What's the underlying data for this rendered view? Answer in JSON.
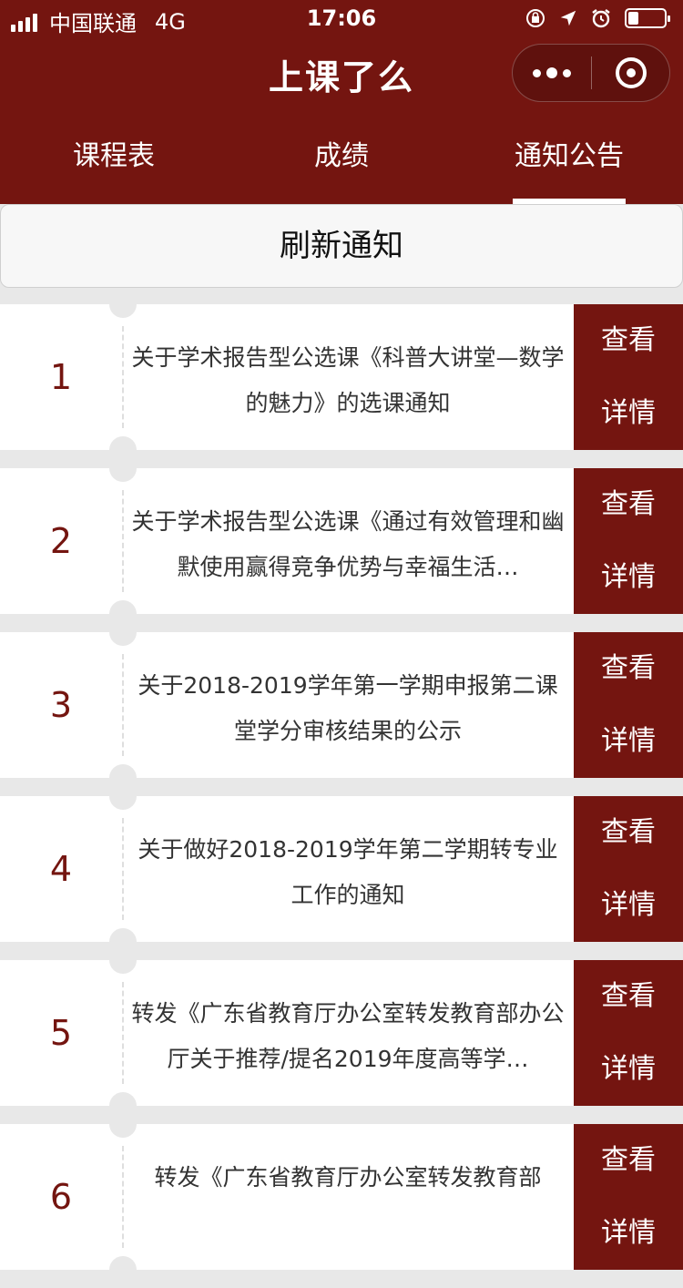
{
  "status_bar": {
    "carrier": "中国联通",
    "network": "4G",
    "time": "17:06",
    "battery_level": 0.25
  },
  "nav": {
    "title": "上课了么",
    "more_icon": "more-dots-icon",
    "close_icon": "target-circle-icon"
  },
  "tabs": [
    {
      "label": "课程表"
    },
    {
      "label": "成绩"
    },
    {
      "label": "通知公告"
    }
  ],
  "active_tab": 2,
  "refresh_button": "刷新通知",
  "notices": [
    {
      "num": "1",
      "title": "关于学术报告型公选课《科普大讲堂—数学的魅力》的选课通知",
      "detail_line1": "查看",
      "detail_line2": "详情"
    },
    {
      "num": "2",
      "title": "关于学术报告型公选课《通过有效管理和幽默使用赢得竞争优势与幸福生活…",
      "detail_line1": "查看",
      "detail_line2": "详情"
    },
    {
      "num": "3",
      "title": "关于2018-2019学年第一学期申报第二课堂学分审核结果的公示",
      "detail_line1": "查看",
      "detail_line2": "详情"
    },
    {
      "num": "4",
      "title": "关于做好2018-2019学年第二学期转专业工作的通知",
      "detail_line1": "查看",
      "detail_line2": "详情"
    },
    {
      "num": "5",
      "title": "转发《广东省教育厅办公室转发教育部办公厅关于推荐/提名2019年度高等学…",
      "detail_line1": "查看",
      "detail_line2": "详情"
    },
    {
      "num": "6",
      "title": "转发《广东省教育厅办公室转发教育部",
      "detail_line1": "查看",
      "detail_line2": "详情"
    }
  ],
  "colors": {
    "brand": "#741510",
    "background": "#e8e8e8"
  }
}
